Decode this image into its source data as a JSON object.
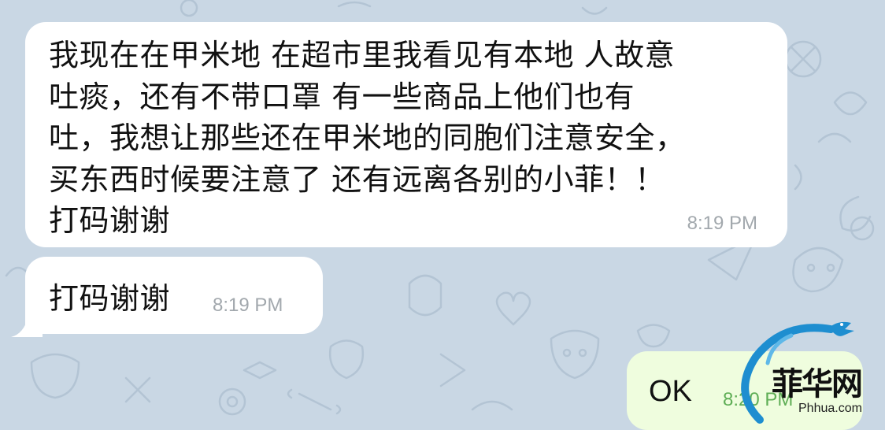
{
  "messages": [
    {
      "direction": "incoming",
      "text": "我现在在甲米地 在超市里我看见有本地  人故意\n吐痰，还有不带口罩 有一些商品上他们也有\n吐，我想让那些还在甲米地的同胞们注意安全，\n买东西时候要注意了 还有远离各别的小菲！！\n打码谢谢",
      "time": "8:19 PM"
    },
    {
      "direction": "incoming",
      "text": "打码谢谢",
      "time": "8:19 PM"
    },
    {
      "direction": "outgoing",
      "text": "OK",
      "time": "8:20 PM"
    }
  ],
  "watermark": {
    "logo_text": "菲华网",
    "site": "Phhua.com"
  },
  "colors": {
    "wallpaper": "#c9d7e4",
    "incoming_bubble": "#ffffff",
    "outgoing_bubble": "#effdde",
    "outgoing_time": "#5fae56",
    "incoming_time": "#a2a8ad"
  }
}
